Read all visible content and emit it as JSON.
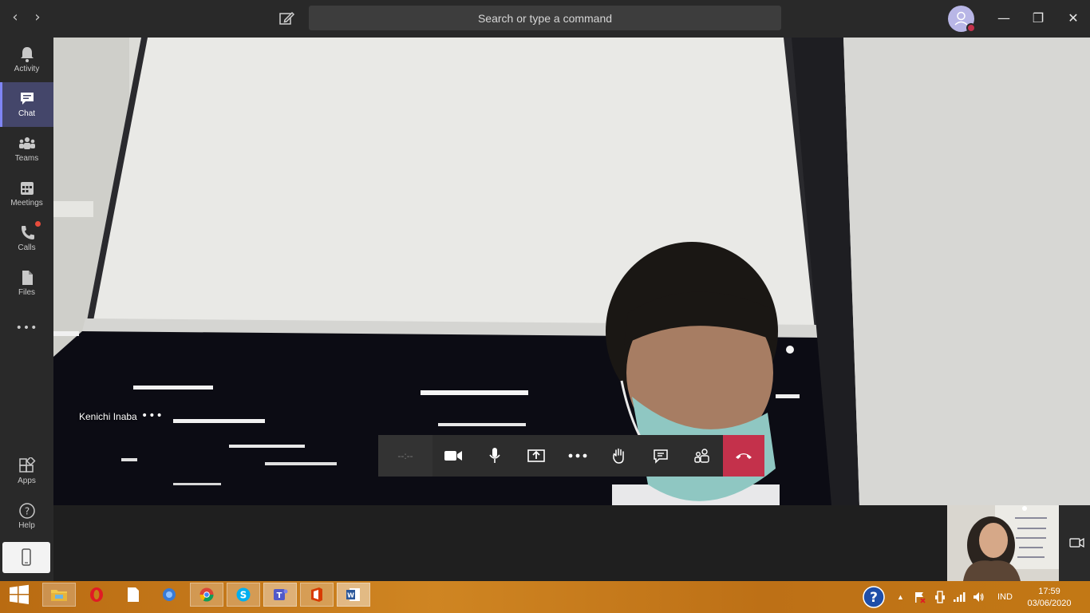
{
  "titlebar": {
    "search_placeholder": "Search or type a command",
    "back_icon": "chevron-left-icon",
    "forward_icon": "chevron-right-icon",
    "compose_icon": "compose-icon",
    "minimize": "—",
    "maximize": "❐",
    "close": "✕"
  },
  "rail": {
    "items": [
      {
        "label": "Activity",
        "icon": "bell-icon"
      },
      {
        "label": "Chat",
        "icon": "chat-icon",
        "active": true
      },
      {
        "label": "Teams",
        "icon": "teams-icon"
      },
      {
        "label": "Meetings",
        "icon": "calendar-icon"
      },
      {
        "label": "Calls",
        "icon": "phone-icon",
        "badge": true
      },
      {
        "label": "Files",
        "icon": "file-icon"
      },
      {
        "label": "•••",
        "icon": "more-icon"
      }
    ],
    "bottom": [
      {
        "label": "Apps",
        "icon": "apps-icon"
      },
      {
        "label": "Help",
        "icon": "help-icon"
      }
    ]
  },
  "call": {
    "participant_name": "Kenichi Inaba",
    "participant_more": "•••",
    "timer": "--:--",
    "controls": [
      "camera-icon",
      "mic-icon",
      "share-screen-icon",
      "more-actions-icon",
      "raise-hand-icon",
      "chat-icon",
      "participants-icon",
      "hang-up-icon"
    ],
    "hangup_color": "#c4314b"
  },
  "taskbar": {
    "language": "IND",
    "time": "17:59",
    "date": "03/06/2020",
    "apps": [
      "file-explorer",
      "opera",
      "notes",
      "chrome-alt",
      "chrome",
      "skype",
      "teams",
      "office",
      "word"
    ]
  }
}
